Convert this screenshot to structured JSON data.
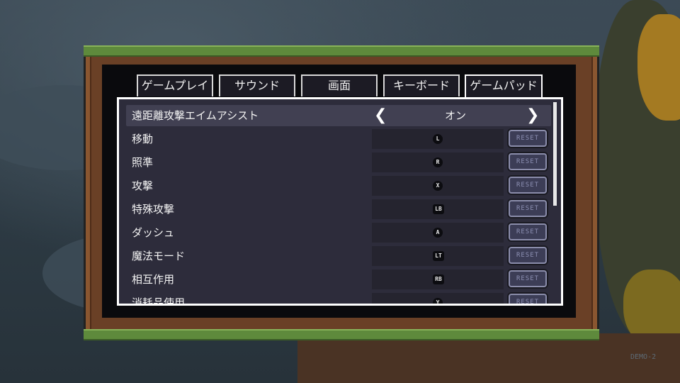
{
  "tabs": [
    {
      "label": "ゲームプレイ",
      "active": false
    },
    {
      "label": "サウンド",
      "active": false
    },
    {
      "label": "画面",
      "active": false
    },
    {
      "label": "キーボード",
      "active": false
    },
    {
      "label": "ゲームパッド",
      "active": true
    }
  ],
  "settings": {
    "aim_assist": {
      "label": "遠距離攻撃エイムアシスト",
      "value": "オン",
      "prev_icon": "❮",
      "next_icon": "❯"
    },
    "bindings": [
      {
        "label": "移動",
        "button": "L",
        "shape": "round"
      },
      {
        "label": "照準",
        "button": "R",
        "shape": "round"
      },
      {
        "label": "攻撃",
        "button": "X",
        "shape": "round"
      },
      {
        "label": "特殊攻撃",
        "button": "LB",
        "shape": "square"
      },
      {
        "label": "ダッシュ",
        "button": "A",
        "shape": "round"
      },
      {
        "label": "魔法モード",
        "button": "LT",
        "shape": "square"
      },
      {
        "label": "相互作用",
        "button": "RB",
        "shape": "square"
      },
      {
        "label": "消耗品使用",
        "button": "Y",
        "shape": "round"
      }
    ],
    "reset_label": "RESET"
  },
  "watermark": "DEMO-2",
  "colors": {
    "panel_bg": "#2d2c3b",
    "frame_dirt": "#6a4026",
    "grass": "#5e8a3c",
    "reset_text": "#8d90b4"
  }
}
